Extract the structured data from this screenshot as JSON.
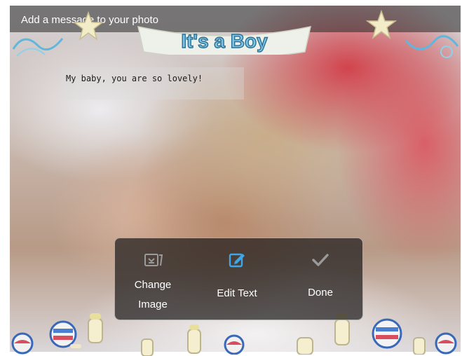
{
  "header": {
    "title": "Add a message to your photo"
  },
  "banner": {
    "text": "It's a Boy"
  },
  "message": {
    "text": "My baby, you are so lovely!"
  },
  "actions": {
    "change_image": {
      "line1": "Change",
      "line2": "Image",
      "icon": "change-image-icon"
    },
    "edit_text": {
      "label": "Edit Text",
      "icon": "edit-text-icon"
    },
    "done": {
      "label": "Done",
      "icon": "checkmark-icon"
    }
  },
  "colors": {
    "edit_icon": "#3da7e8",
    "banner_text": "#7fc4e4",
    "panel": "#1e1c1c"
  }
}
